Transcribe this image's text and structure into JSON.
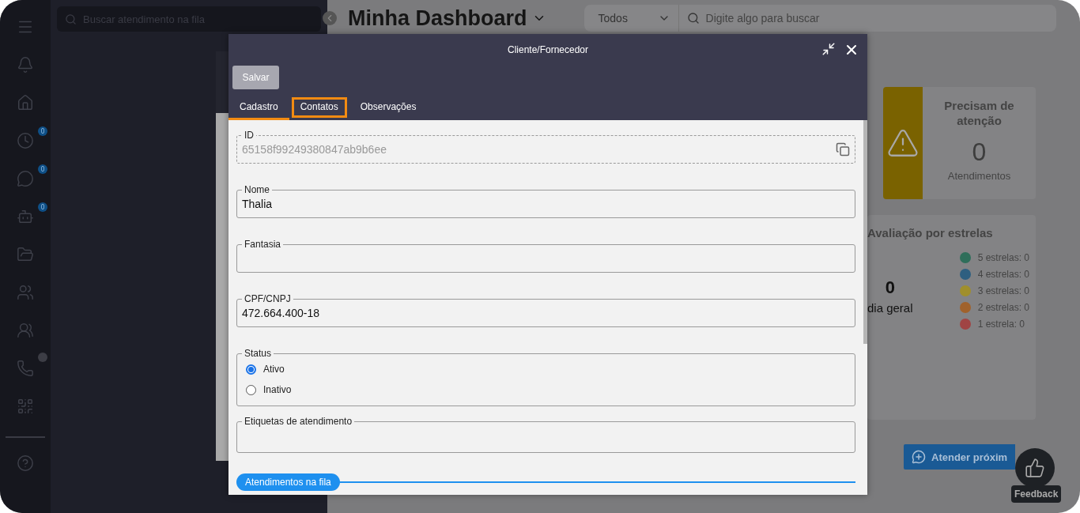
{
  "sidebar": {
    "items": [
      {
        "kind": "menu"
      },
      {
        "kind": "bell"
      },
      {
        "kind": "home"
      },
      {
        "kind": "clock",
        "badge": "0"
      },
      {
        "kind": "chat",
        "badge": "0"
      },
      {
        "kind": "robot",
        "badge": "0"
      },
      {
        "kind": "folder"
      },
      {
        "kind": "users"
      },
      {
        "kind": "group"
      },
      {
        "kind": "phone",
        "color": "#3c3d45"
      },
      {
        "kind": "qr"
      },
      {
        "kind": "divider"
      },
      {
        "kind": "help"
      }
    ]
  },
  "queue": {
    "search": {
      "placeholder": "Buscar atendimento na fila"
    }
  },
  "dashboard": {
    "title": "Minha Dashboard",
    "filter": {
      "value": "Todos"
    },
    "search": {
      "placeholder": "Digite algo para buscar"
    },
    "attention_card": {
      "title": "Precisam de atenção",
      "count": "0",
      "caption": "Atendimentos"
    },
    "stars_card": {
      "title": "Avaliação por estrelas",
      "average": "0",
      "average_label": "dia geral",
      "legend": [
        {
          "label": "5 estrelas: 0",
          "color": "#2f6e5a"
        },
        {
          "label": "4 estrelas: 0",
          "color": "#2e5f80"
        },
        {
          "label": "3 estrelas: 0",
          "color": "#a08f2c"
        },
        {
          "label": "2 estrelas: 0",
          "color": "#a0622c"
        },
        {
          "label": "1 estrela: 0",
          "color": "#a04444"
        }
      ]
    },
    "next_button": "Atender próxim"
  },
  "feedback": {
    "label": "Feedback"
  },
  "dialog": {
    "title": "Cliente/Fornecedor",
    "save_button": {
      "label": "Salvar",
      "disabled": true
    },
    "tabs": [
      {
        "label": "Cadastro",
        "selected": true,
        "focused": false
      },
      {
        "label": "Contatos",
        "selected": false,
        "focused": true
      },
      {
        "label": "Observações",
        "selected": false,
        "focused": false
      }
    ],
    "fields": [
      {
        "kind": "id",
        "label": "ID",
        "value": "65158f99249380847ab9b6ee"
      },
      {
        "kind": "text",
        "label": "Nome",
        "value": "Thalia"
      },
      {
        "kind": "text",
        "label": "Fantasia"
      },
      {
        "kind": "masked",
        "label": "CPF/CNPJ",
        "value": "472.664.400-18"
      },
      {
        "kind": "radio",
        "label": "Status",
        "options": [
          {
            "label": "Ativo",
            "selected": true
          },
          {
            "label": "Inativo",
            "selected": false
          }
        ]
      },
      {
        "kind": "text",
        "label": "Etiquetas de atendimento"
      }
    ],
    "section": "Atendimentos na fila"
  }
}
